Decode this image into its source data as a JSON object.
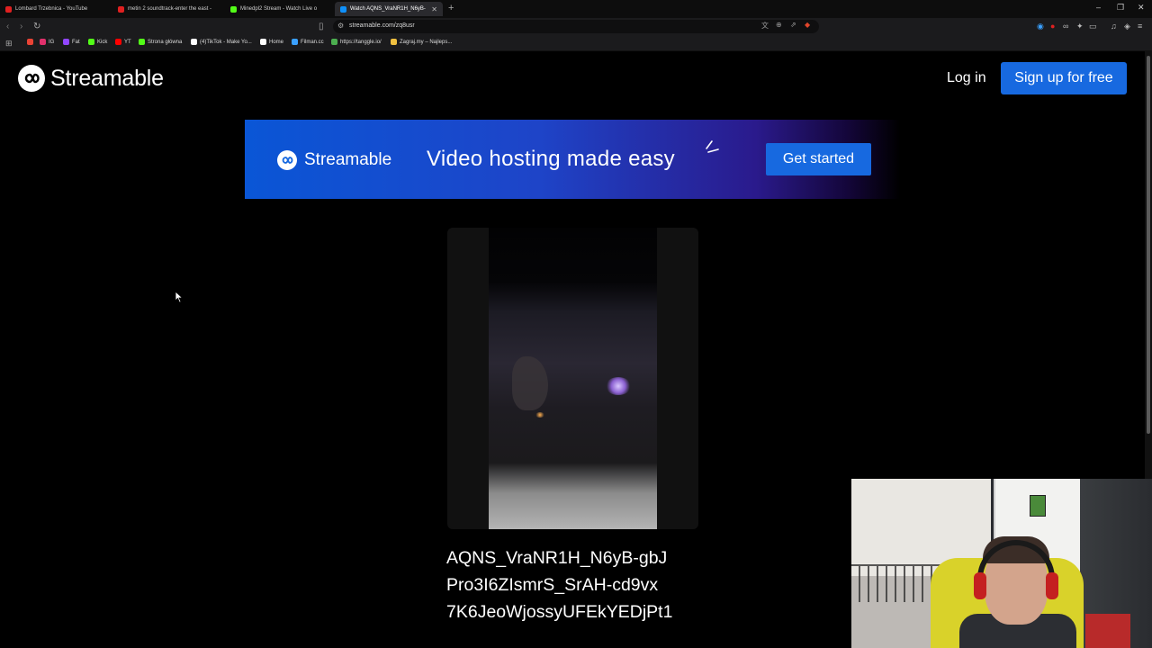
{
  "browser": {
    "tabs": [
      {
        "title": "Lombard Trzebnica - YouTube",
        "fav_color": "#e02020"
      },
      {
        "title": "metin 2 soundtrack-enter the east - ",
        "fav_color": "#e02020"
      },
      {
        "title": "Minedpl2 Stream - Watch Live o",
        "fav_color": "#53fc18"
      },
      {
        "title": "Watch AQNS_VraNR1H_N6yB-",
        "fav_color": "#0f90fa"
      }
    ],
    "url": "streamable.com/zq8usr",
    "bookmarks": [
      {
        "label": "IG",
        "color": "#e1306c"
      },
      {
        "label": "Fat",
        "color": "#9146ff"
      },
      {
        "label": "Kick",
        "color": "#53fc18"
      },
      {
        "label": "YT",
        "color": "#ff0000"
      },
      {
        "label": "Strona główna",
        "color": "#53fc18"
      },
      {
        "label": "(4)TikTok - Make Yo...",
        "color": "#ffffff"
      },
      {
        "label": "Home",
        "color": "#ffffff"
      },
      {
        "label": "Filman.cc",
        "color": "#3aa0ff"
      },
      {
        "label": "https://tanggle.io/",
        "color": "#4caf50"
      },
      {
        "label": "Zagraj.my – Najleps...",
        "color": "#f0c040"
      }
    ]
  },
  "header": {
    "logo_text": "Streamable",
    "login_label": "Log in",
    "signup_label": "Sign up for free"
  },
  "banner": {
    "logo_text": "Streamable",
    "tagline": "Video hosting made easy",
    "cta_label": "Get started"
  },
  "video": {
    "title_lines": [
      "AQNS_VraNR1H_N6yB-gbJ",
      "Pro3I6ZIsmrS_SrAH-cd9vx",
      "7K6JeoWjossyUFEkYEDjPt1"
    ]
  },
  "colors": {
    "accent": "#1769e0",
    "page_bg": "#000000"
  }
}
